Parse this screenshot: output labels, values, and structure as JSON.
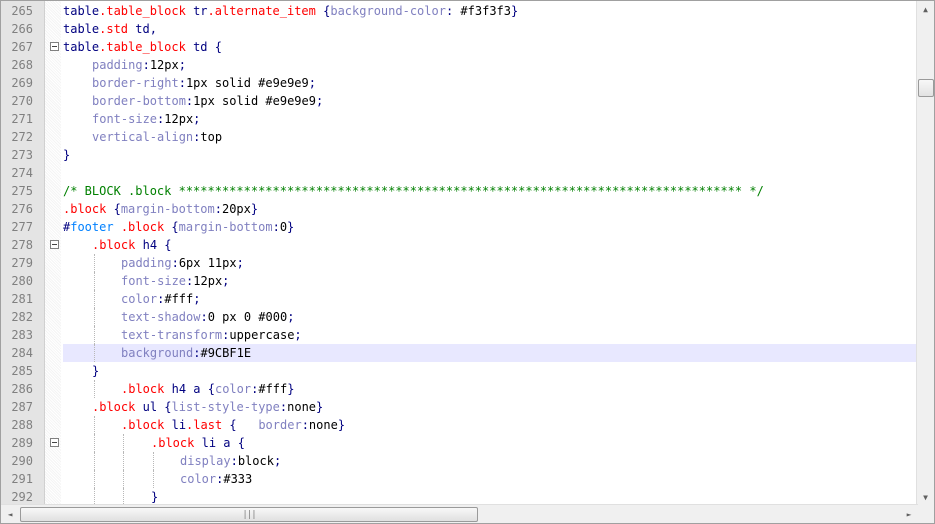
{
  "editor": {
    "current_line": 284,
    "lines": [
      {
        "n": "265",
        "fold": false,
        "indent": 0,
        "tokens": [
          [
            "t-sel",
            "table"
          ],
          [
            "t-cls",
            ".table_block"
          ],
          [
            "t-pl",
            " "
          ],
          [
            "t-sel",
            "tr"
          ],
          [
            "t-cls",
            ".alternate_item"
          ],
          [
            "t-pl",
            " "
          ],
          [
            "t-op",
            "{"
          ],
          [
            "t-prop",
            "background-color"
          ],
          [
            "t-op",
            ":"
          ],
          [
            "t-pl",
            " "
          ],
          [
            "t-val",
            "#f3f3f3"
          ],
          [
            "t-op",
            "}"
          ]
        ]
      },
      {
        "n": "266",
        "fold": false,
        "indent": 0,
        "tokens": [
          [
            "t-sel",
            "table"
          ],
          [
            "t-cls",
            ".std"
          ],
          [
            "t-pl",
            " "
          ],
          [
            "t-sel",
            "td"
          ],
          [
            "t-op",
            ","
          ]
        ]
      },
      {
        "n": "267",
        "fold": true,
        "indent": 0,
        "tokens": [
          [
            "t-sel",
            "table"
          ],
          [
            "t-cls",
            ".table_block"
          ],
          [
            "t-pl",
            " "
          ],
          [
            "t-sel",
            "td"
          ],
          [
            "t-pl",
            " "
          ],
          [
            "t-op",
            "{"
          ]
        ]
      },
      {
        "n": "268",
        "fold": false,
        "indent": 1,
        "tokens": [
          [
            "t-prop",
            "padding"
          ],
          [
            "t-op",
            ":"
          ],
          [
            "t-val",
            "12px"
          ],
          [
            "t-op",
            ";"
          ]
        ]
      },
      {
        "n": "269",
        "fold": false,
        "indent": 1,
        "tokens": [
          [
            "t-prop",
            "border-right"
          ],
          [
            "t-op",
            ":"
          ],
          [
            "t-val",
            "1px solid #e9e9e9"
          ],
          [
            "t-op",
            ";"
          ]
        ]
      },
      {
        "n": "270",
        "fold": false,
        "indent": 1,
        "tokens": [
          [
            "t-prop",
            "border-bottom"
          ],
          [
            "t-op",
            ":"
          ],
          [
            "t-val",
            "1px solid #e9e9e9"
          ],
          [
            "t-op",
            ";"
          ]
        ]
      },
      {
        "n": "271",
        "fold": false,
        "indent": 1,
        "tokens": [
          [
            "t-prop",
            "font-size"
          ],
          [
            "t-op",
            ":"
          ],
          [
            "t-val",
            "12px"
          ],
          [
            "t-op",
            ";"
          ]
        ]
      },
      {
        "n": "272",
        "fold": false,
        "indent": 1,
        "tokens": [
          [
            "t-prop",
            "vertical-align"
          ],
          [
            "t-op",
            ":"
          ],
          [
            "t-val",
            "top"
          ]
        ]
      },
      {
        "n": "273",
        "fold": false,
        "indent": 0,
        "tokens": [
          [
            "t-op",
            "}"
          ]
        ]
      },
      {
        "n": "274",
        "fold": false,
        "indent": 0,
        "tokens": []
      },
      {
        "n": "275",
        "fold": false,
        "indent": 0,
        "tokens": [
          [
            "t-cmt",
            "/* BLOCK .block ****************************************************************************** */"
          ]
        ]
      },
      {
        "n": "276",
        "fold": false,
        "indent": 0,
        "tokens": [
          [
            "t-cls",
            ".block"
          ],
          [
            "t-pl",
            " "
          ],
          [
            "t-op",
            "{"
          ],
          [
            "t-prop",
            "margin-bottom"
          ],
          [
            "t-op",
            ":"
          ],
          [
            "t-val",
            "20px"
          ],
          [
            "t-op",
            "}"
          ]
        ]
      },
      {
        "n": "277",
        "fold": false,
        "indent": 0,
        "tokens": [
          [
            "t-sel",
            "#"
          ],
          [
            "t-id",
            "footer"
          ],
          [
            "t-pl",
            " "
          ],
          [
            "t-cls",
            ".block"
          ],
          [
            "t-pl",
            " "
          ],
          [
            "t-op",
            "{"
          ],
          [
            "t-prop",
            "margin-bottom"
          ],
          [
            "t-op",
            ":"
          ],
          [
            "t-val",
            "0"
          ],
          [
            "t-op",
            "}"
          ]
        ]
      },
      {
        "n": "278",
        "fold": true,
        "indent": 1,
        "tokens": [
          [
            "t-cls",
            ".block"
          ],
          [
            "t-pl",
            " "
          ],
          [
            "t-sel",
            "h4"
          ],
          [
            "t-pl",
            " "
          ],
          [
            "t-op",
            "{"
          ]
        ]
      },
      {
        "n": "279",
        "fold": false,
        "indent": 2,
        "tokens": [
          [
            "t-prop",
            "padding"
          ],
          [
            "t-op",
            ":"
          ],
          [
            "t-val",
            "6px 11px"
          ],
          [
            "t-op",
            ";"
          ]
        ]
      },
      {
        "n": "280",
        "fold": false,
        "indent": 2,
        "tokens": [
          [
            "t-prop",
            "font-size"
          ],
          [
            "t-op",
            ":"
          ],
          [
            "t-val",
            "12px"
          ],
          [
            "t-op",
            ";"
          ]
        ]
      },
      {
        "n": "281",
        "fold": false,
        "indent": 2,
        "tokens": [
          [
            "t-prop",
            "color"
          ],
          [
            "t-op",
            ":"
          ],
          [
            "t-val",
            "#fff"
          ],
          [
            "t-op",
            ";"
          ]
        ]
      },
      {
        "n": "282",
        "fold": false,
        "indent": 2,
        "tokens": [
          [
            "t-prop",
            "text-shadow"
          ],
          [
            "t-op",
            ":"
          ],
          [
            "t-val",
            "0 px 0 #000"
          ],
          [
            "t-op",
            ";"
          ]
        ]
      },
      {
        "n": "283",
        "fold": false,
        "indent": 2,
        "tokens": [
          [
            "t-prop",
            "text-transform"
          ],
          [
            "t-op",
            ":"
          ],
          [
            "t-val",
            "uppercase"
          ],
          [
            "t-op",
            ";"
          ]
        ]
      },
      {
        "n": "284",
        "fold": false,
        "indent": 2,
        "tokens": [
          [
            "t-prop",
            "background"
          ],
          [
            "t-op",
            ":"
          ],
          [
            "t-val",
            "#9CBF1E"
          ]
        ]
      },
      {
        "n": "285",
        "fold": false,
        "indent": 1,
        "tokens": [
          [
            "t-op",
            "}"
          ]
        ]
      },
      {
        "n": "286",
        "fold": false,
        "indent": 2,
        "tokens": [
          [
            "t-cls",
            ".block"
          ],
          [
            "t-pl",
            " "
          ],
          [
            "t-sel",
            "h4"
          ],
          [
            "t-pl",
            " "
          ],
          [
            "t-sel",
            "a"
          ],
          [
            "t-pl",
            " "
          ],
          [
            "t-op",
            "{"
          ],
          [
            "t-prop",
            "color"
          ],
          [
            "t-op",
            ":"
          ],
          [
            "t-val",
            "#fff"
          ],
          [
            "t-op",
            "}"
          ]
        ]
      },
      {
        "n": "287",
        "fold": false,
        "indent": 1,
        "tokens": [
          [
            "t-cls",
            ".block"
          ],
          [
            "t-pl",
            " "
          ],
          [
            "t-sel",
            "ul"
          ],
          [
            "t-pl",
            " "
          ],
          [
            "t-op",
            "{"
          ],
          [
            "t-prop",
            "list-style-type"
          ],
          [
            "t-op",
            ":"
          ],
          [
            "t-val",
            "none"
          ],
          [
            "t-op",
            "}"
          ]
        ]
      },
      {
        "n": "288",
        "fold": false,
        "indent": 2,
        "tokens": [
          [
            "t-cls",
            ".block"
          ],
          [
            "t-pl",
            " "
          ],
          [
            "t-sel",
            "li"
          ],
          [
            "t-cls",
            ".last"
          ],
          [
            "t-pl",
            " "
          ],
          [
            "t-op",
            "{"
          ],
          [
            "t-pl",
            "   "
          ],
          [
            "t-prop",
            "border"
          ],
          [
            "t-op",
            ":"
          ],
          [
            "t-val",
            "none"
          ],
          [
            "t-op",
            "}"
          ]
        ]
      },
      {
        "n": "289",
        "fold": true,
        "indent": 3,
        "tokens": [
          [
            "t-cls",
            ".block"
          ],
          [
            "t-pl",
            " "
          ],
          [
            "t-sel",
            "li"
          ],
          [
            "t-pl",
            " "
          ],
          [
            "t-sel",
            "a"
          ],
          [
            "t-pl",
            " "
          ],
          [
            "t-op",
            "{"
          ]
        ]
      },
      {
        "n": "290",
        "fold": false,
        "indent": 4,
        "tokens": [
          [
            "t-prop",
            "display"
          ],
          [
            "t-op",
            ":"
          ],
          [
            "t-val",
            "block"
          ],
          [
            "t-op",
            ";"
          ]
        ]
      },
      {
        "n": "291",
        "fold": false,
        "indent": 4,
        "tokens": [
          [
            "t-prop",
            "color"
          ],
          [
            "t-op",
            ":"
          ],
          [
            "t-val",
            "#333"
          ]
        ]
      },
      {
        "n": "292",
        "fold": false,
        "indent": 3,
        "tokens": [
          [
            "t-op",
            "}"
          ]
        ]
      }
    ]
  },
  "scrollbars": {
    "up_arrow": "▲",
    "down_arrow": "▼",
    "left_arrow": "◄",
    "right_arrow": "►",
    "grip": "|||"
  }
}
